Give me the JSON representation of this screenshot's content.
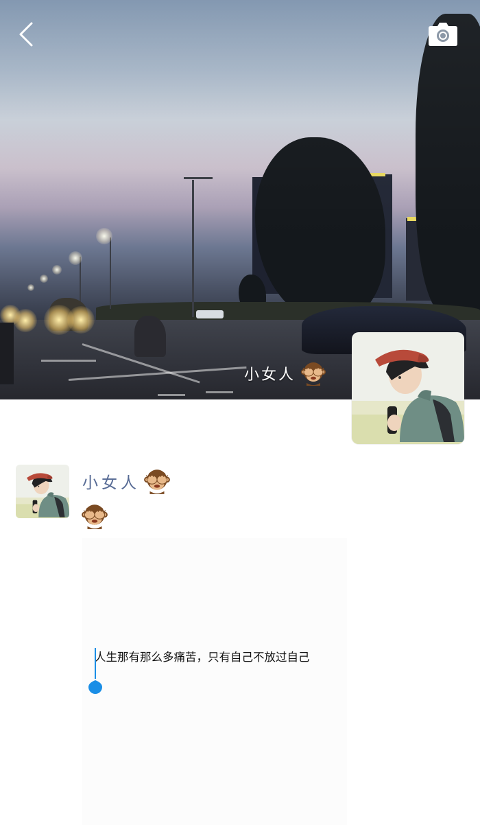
{
  "header": {
    "back_icon": "chevron-left-icon",
    "camera_icon": "camera-icon"
  },
  "profile": {
    "nickname": "小女人",
    "nickname_emoji": "see-no-evil-monkey-icon"
  },
  "post": {
    "author": "小女人",
    "text_emoji": "see-no-evil-monkey-icon",
    "shared_caption": "人生那有那么多痛苦，只有自己不放过自己"
  },
  "colors": {
    "name_link": "#576b95",
    "selection_cursor": "#1a8ee6",
    "background": "#ffffff"
  }
}
